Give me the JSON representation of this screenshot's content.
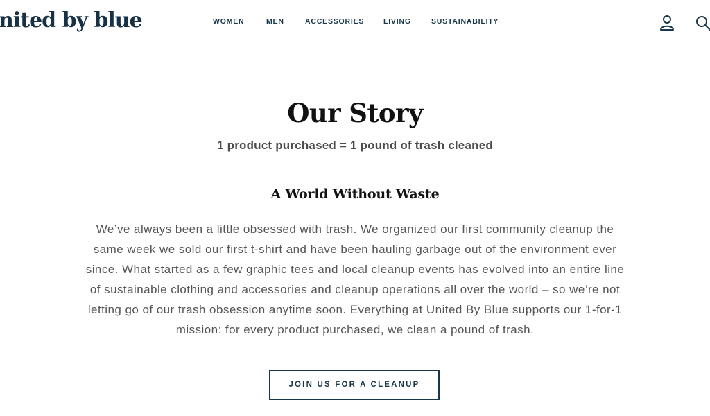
{
  "header": {
    "brand": "nited by blue",
    "nav": [
      {
        "label": "WOMEN"
      },
      {
        "label": "MEN"
      },
      {
        "label": "ACCESSORIES"
      },
      {
        "label": "LIVING"
      },
      {
        "label": "SUSTAINABILITY"
      }
    ],
    "icons": {
      "account": "user-icon",
      "search": "search-icon"
    },
    "colors": {
      "brand": "#173246",
      "nav_text": "#18374c",
      "background": "#ffffff"
    }
  },
  "main": {
    "title": "Our Story",
    "tagline": "1 product purchased = 1 pound of trash cleaned",
    "section_title": "A World Without Waste",
    "paragraph": "We’ve always been a little obsessed with trash. We organized our first community cleanup the same week we sold our first t-shirt and have been hauling garbage out of the environment ever since. What started as a few graphic tees and local cleanup events has evolved into an entire line of sustainable clothing and accessories and cleanup operations all over the world – so we’re not letting go of our trash obsession anytime soon. Everything at United By Blue supports our 1-for-1 mission: for every product purchased, we clean a pound of trash.",
    "cta_label": "JOIN US FOR A CLEANUP",
    "colors": {
      "title": "#111111",
      "tagline": "#4c4c4c",
      "body": "#555555",
      "button_border": "#18374c"
    }
  }
}
